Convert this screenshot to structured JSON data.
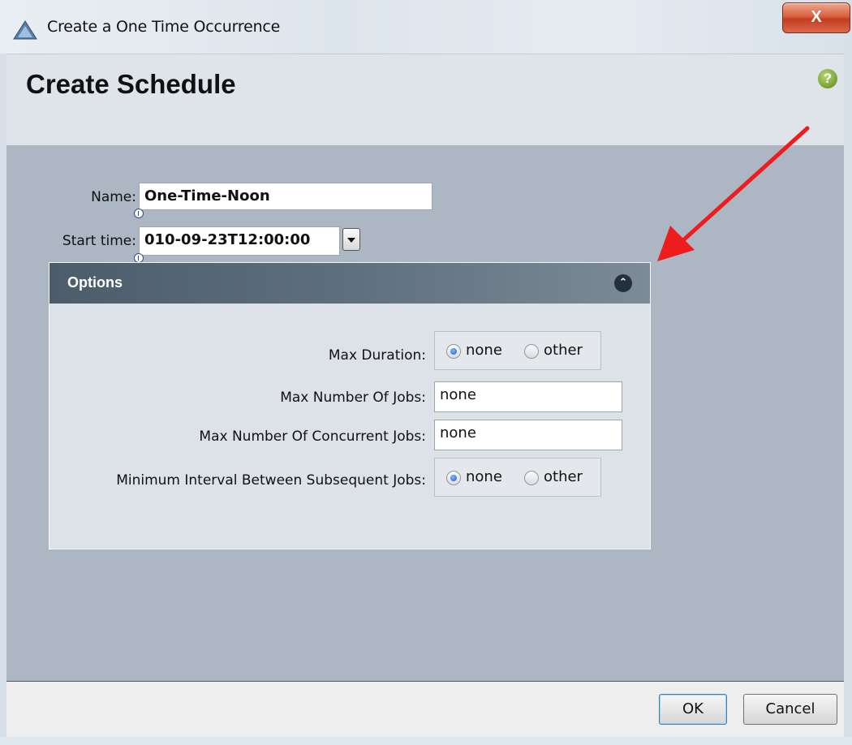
{
  "window": {
    "title": "Create a One Time Occurrence",
    "close_label": "X"
  },
  "header": {
    "title": "Create Schedule",
    "help_label": "?"
  },
  "form": {
    "name_label": "Name:",
    "name_value": "One-Time-Noon",
    "start_label": "Start time:",
    "start_value": "010-09-23T12:00:00"
  },
  "options": {
    "title": "Options",
    "max_duration_label": "Max Duration:",
    "max_duration_options": [
      "none",
      "other"
    ],
    "max_duration_selected": "none",
    "max_jobs_label": "Max Number Of Jobs:",
    "max_jobs_value": "none",
    "max_concurrent_label": "Max Number Of Concurrent Jobs:",
    "max_concurrent_value": "none",
    "min_interval_label": "Minimum Interval Between Subsequent Jobs:",
    "min_interval_options": [
      "none",
      "other"
    ],
    "min_interval_selected": "none"
  },
  "buttons": {
    "ok": "OK",
    "cancel": "Cancel"
  },
  "colors": {
    "annotation_arrow": "#ee1c1c",
    "main_background": "#acb7c3",
    "options_header": "#4c5c6b"
  }
}
